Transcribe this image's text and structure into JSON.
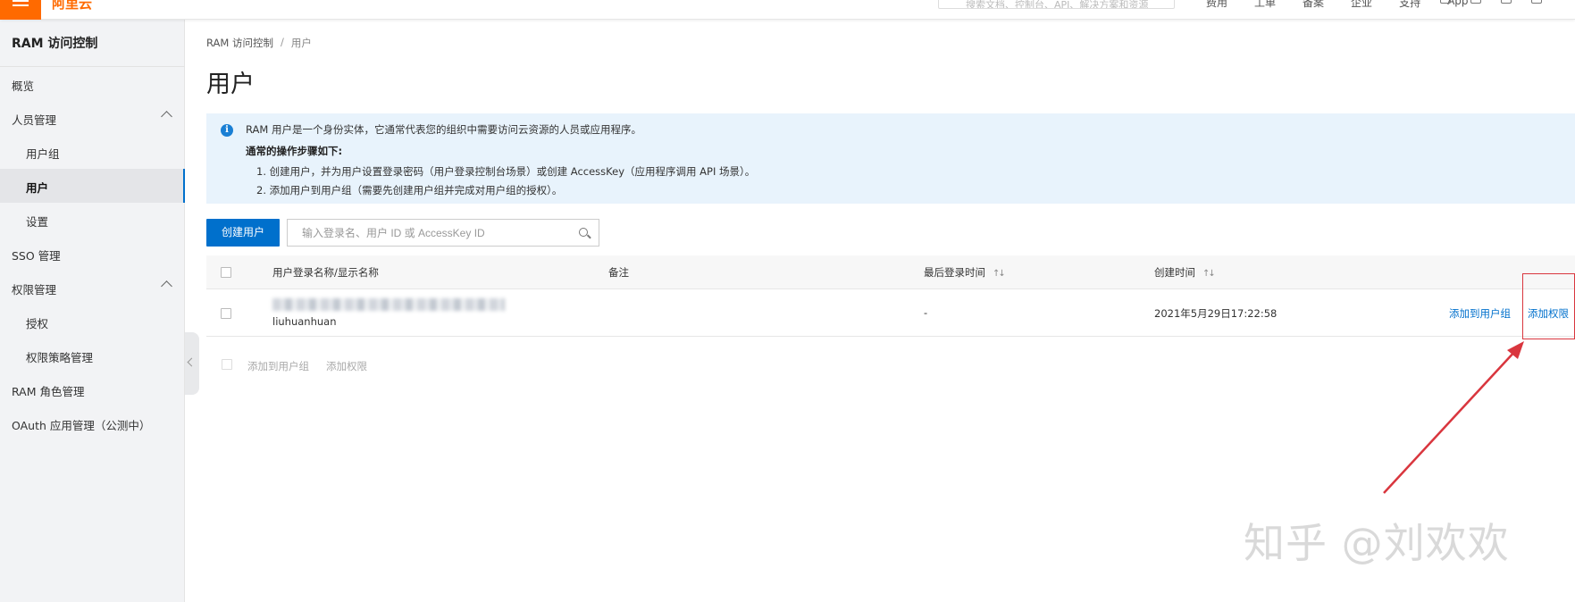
{
  "topbar": {
    "logo_text": "阿里云",
    "search_placeholder": "搜索文档、控制台、API、解决方案和资源",
    "links": [
      "费用",
      "工单",
      "备案",
      "企业",
      "支持",
      "App"
    ]
  },
  "sidebar": {
    "title": "RAM 访问控制",
    "items": [
      {
        "label": "概览",
        "level": 1
      },
      {
        "label": "人员管理",
        "level": 1,
        "expanded": true
      },
      {
        "label": "用户组",
        "level": 2
      },
      {
        "label": "用户",
        "level": 2,
        "active": true
      },
      {
        "label": "设置",
        "level": 2
      },
      {
        "label": "SSO 管理",
        "level": 1
      },
      {
        "label": "权限管理",
        "level": 1,
        "expanded": true
      },
      {
        "label": "授权",
        "level": 2
      },
      {
        "label": "权限策略管理",
        "level": 2
      },
      {
        "label": "RAM 角色管理",
        "level": 1
      },
      {
        "label": "OAuth 应用管理（公测中）",
        "level": 1
      }
    ]
  },
  "breadcrumb": {
    "root": "RAM 访问控制",
    "sep": "/",
    "current": "用户"
  },
  "page": {
    "title": "用户"
  },
  "notice": {
    "line1": "RAM 用户是一个身份实体，它通常代表您的组织中需要访问云资源的人员或应用程序。",
    "line2": "通常的操作步骤如下:",
    "line3": "1. 创建用户，并为用户设置登录密码（用户登录控制台场景）或创建 AccessKey（应用程序调用 API 场景）。",
    "line4": "2. 添加用户到用户组（需要先创建用户组并完成对用户组的授权）。"
  },
  "toolbar": {
    "create_label": "创建用户",
    "search_placeholder": "输入登录名、用户 ID 或 AccessKey ID"
  },
  "table": {
    "columns": {
      "name": "用户登录名称/显示名称",
      "note": "备注",
      "last_login": "最后登录时间",
      "created": "创建时间",
      "sort_glyph": "↑↓"
    },
    "rows": [
      {
        "login_name": "liuhuanhuan",
        "note": "",
        "last_login": "-",
        "created": "2021年5月29日17:22:58",
        "action_group": "添加到用户组",
        "action_perm": "添加权限"
      }
    ]
  },
  "batch": {
    "add_group": "添加到用户组",
    "add_perm": "添加权限"
  },
  "watermark": "知乎 @刘欢欢",
  "colors": {
    "accent": "#0070cc",
    "brand": "#ff6a00",
    "annotation": "#d9363e"
  }
}
